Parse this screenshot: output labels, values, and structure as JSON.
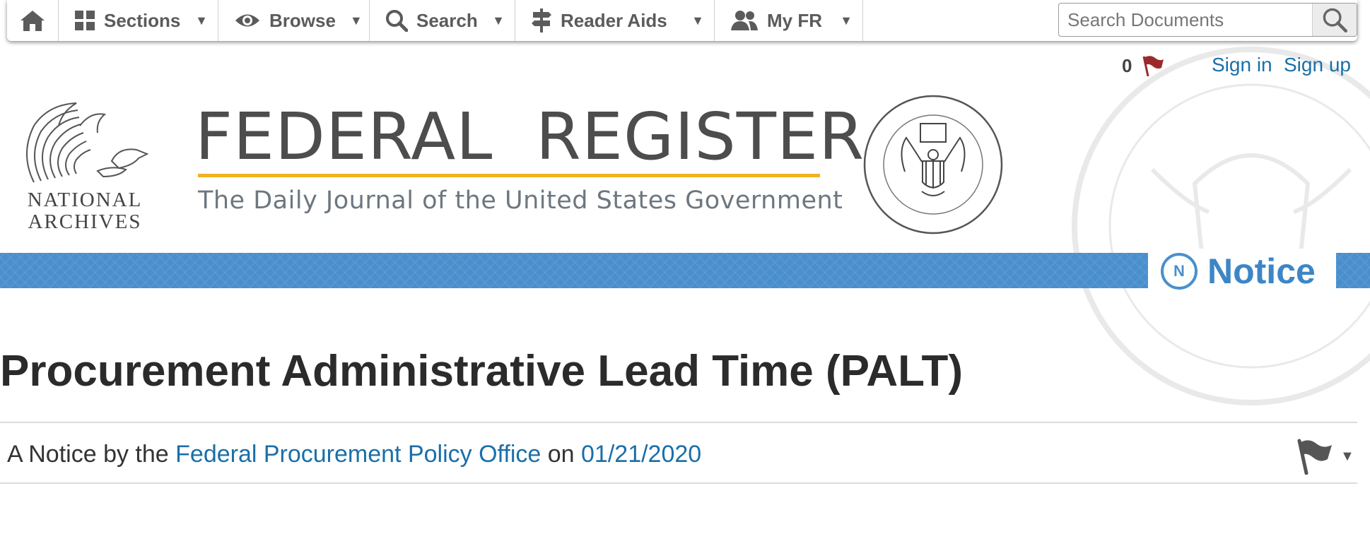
{
  "nav": {
    "items": [
      {
        "label": "Sections",
        "icon": "grid-icon"
      },
      {
        "label": "Browse",
        "icon": "eye-icon"
      },
      {
        "label": "Search",
        "icon": "search-icon"
      },
      {
        "label": "Reader Aids",
        "icon": "signpost-icon"
      },
      {
        "label": "My FR",
        "icon": "users-icon"
      }
    ],
    "caret": "▼",
    "search_placeholder": "Search Documents"
  },
  "user": {
    "flag_count": "0",
    "sign_in": "Sign in",
    "sign_up": "Sign up"
  },
  "masthead": {
    "nara_line1": "NATIONAL",
    "nara_line2": "ARCHIVES",
    "title": "FEDERAL  REGISTER",
    "subtitle": "The Daily Journal of the United States Government"
  },
  "doc_type": {
    "badge_letter": "N",
    "label": "Notice"
  },
  "document": {
    "title": "Procurement Administrative Lead Time (PALT)",
    "byline_prefix": "A Notice by the",
    "agency": "Federal Procurement Policy Office",
    "byline_on": "on",
    "date": "01/21/2020"
  },
  "colors": {
    "accent_blue": "#4a8fcd",
    "link_blue": "#1a6fa8",
    "gold_rule": "#f0b323",
    "flag_red": "#9b2b2b"
  }
}
